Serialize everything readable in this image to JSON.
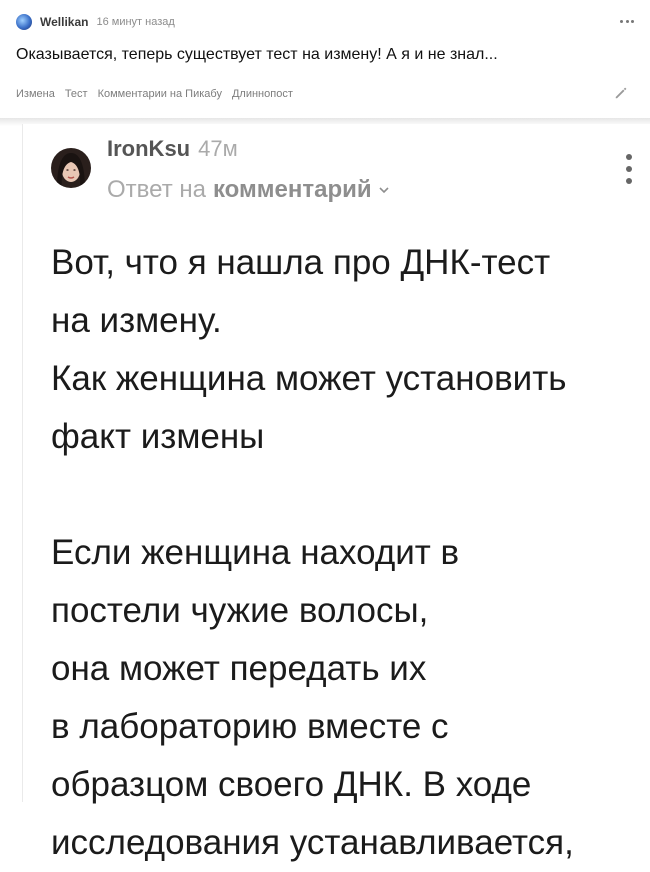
{
  "post": {
    "author": "Wellikan",
    "time": "16 минут назад",
    "title": "Оказывается, теперь существует тест на измену! А я и не знал...",
    "tags": [
      "Измена",
      "Тест",
      "Комментарии на Пикабу",
      "Длиннопост"
    ]
  },
  "comment": {
    "author": "IronKsu",
    "time": "47м",
    "reply_prefix": "Ответ на",
    "reply_target": "комментарий",
    "body": "Вот, что я нашла про ДНК-тест\nна измену.\nКак женщина может установить\nфакт измены\n\nЕсли женщина находит в\nпостели чужие волосы,\nона может передать их\nв лабораторию вместе с\nобразцом своего ДНК. В ходе\nисследования устанавливается,"
  },
  "colors": {
    "accent_text": "#1b1b1b",
    "muted": "#8c8c8c"
  },
  "icons": {
    "avatar_small": "planet-icon",
    "more_top": "more-horizontal-icon",
    "edit": "pencil-icon",
    "more_comment": "more-vertical-icon",
    "chevron": "chevron-down-icon"
  }
}
